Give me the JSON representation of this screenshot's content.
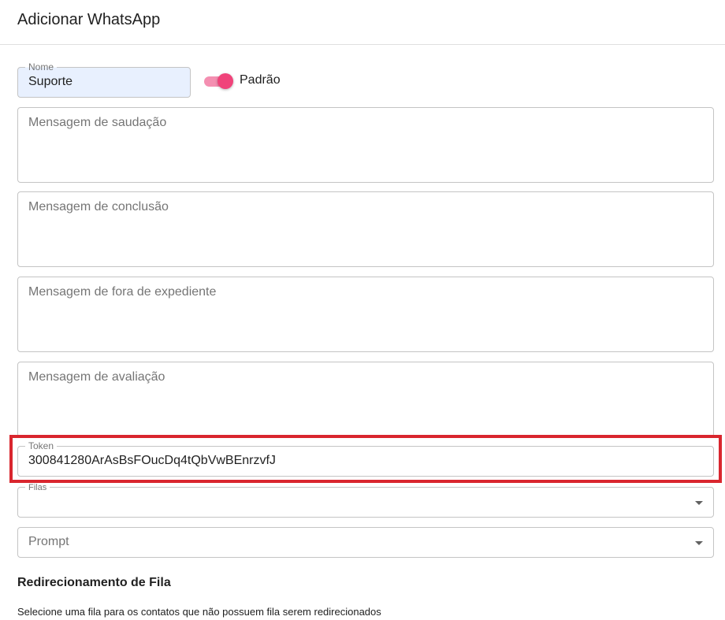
{
  "dialog": {
    "title": "Adicionar WhatsApp"
  },
  "form": {
    "name": {
      "label": "Nome",
      "value": "Suporte"
    },
    "default_switch": {
      "label": "Padrão",
      "checked": true,
      "color": "#f0437a"
    },
    "greeting_message": {
      "placeholder": "Mensagem de saudação"
    },
    "conclusion_message": {
      "placeholder": "Mensagem de conclusão"
    },
    "offhours_message": {
      "placeholder": "Mensagem de fora de expediente"
    },
    "rating_message": {
      "placeholder": "Mensagem de avaliação"
    },
    "token": {
      "label": "Token",
      "value": "300841280ArAsBsFOucDq4tQbVwBEnrzvfJ"
    },
    "queues": {
      "label": "Filas",
      "value": ""
    },
    "prompt": {
      "placeholder": "Prompt",
      "value": ""
    }
  },
  "redirect_section": {
    "title": "Redirecionamento de Fila",
    "description": "Selecione uma fila para os contatos que não possuem fila serem redirecionados"
  },
  "highlight": {
    "color": "#d9262e",
    "target": "token"
  }
}
